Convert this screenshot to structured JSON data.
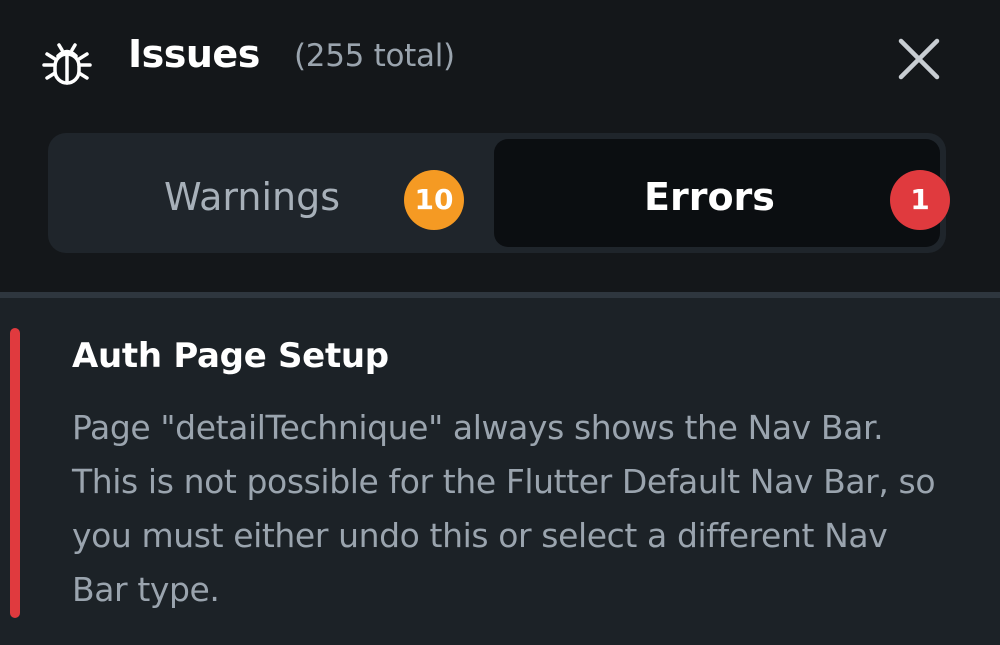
{
  "header": {
    "title": "Issues",
    "subtitle": "(255 total)",
    "icon": "bug-icon",
    "close_icon": "close-icon"
  },
  "tabs": [
    {
      "label": "Warnings",
      "count": "10",
      "selected": false,
      "badge_color": "#f59a23"
    },
    {
      "label": "Errors",
      "count": "1",
      "selected": true,
      "badge_color": "#e03a3e"
    }
  ],
  "issue": {
    "title": "Auth Page Setup",
    "description": "Page \"detailTechnique\" always shows the Nav Bar. This is not possible for the Flutter Default Nav Bar, so you must either undo this or select a different Nav Bar type.",
    "severity_color": "#e03a3e"
  },
  "colors": {
    "background": "#14171a",
    "accent_warning": "#f59a23",
    "accent_error": "#e03a3e"
  }
}
